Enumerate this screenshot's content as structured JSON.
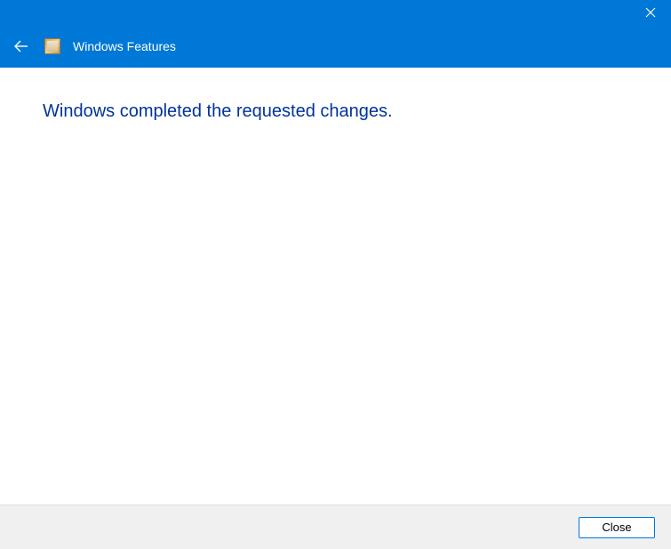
{
  "header": {
    "title": "Windows Features"
  },
  "content": {
    "message": "Windows completed the requested changes."
  },
  "footer": {
    "close_label": "Close"
  }
}
